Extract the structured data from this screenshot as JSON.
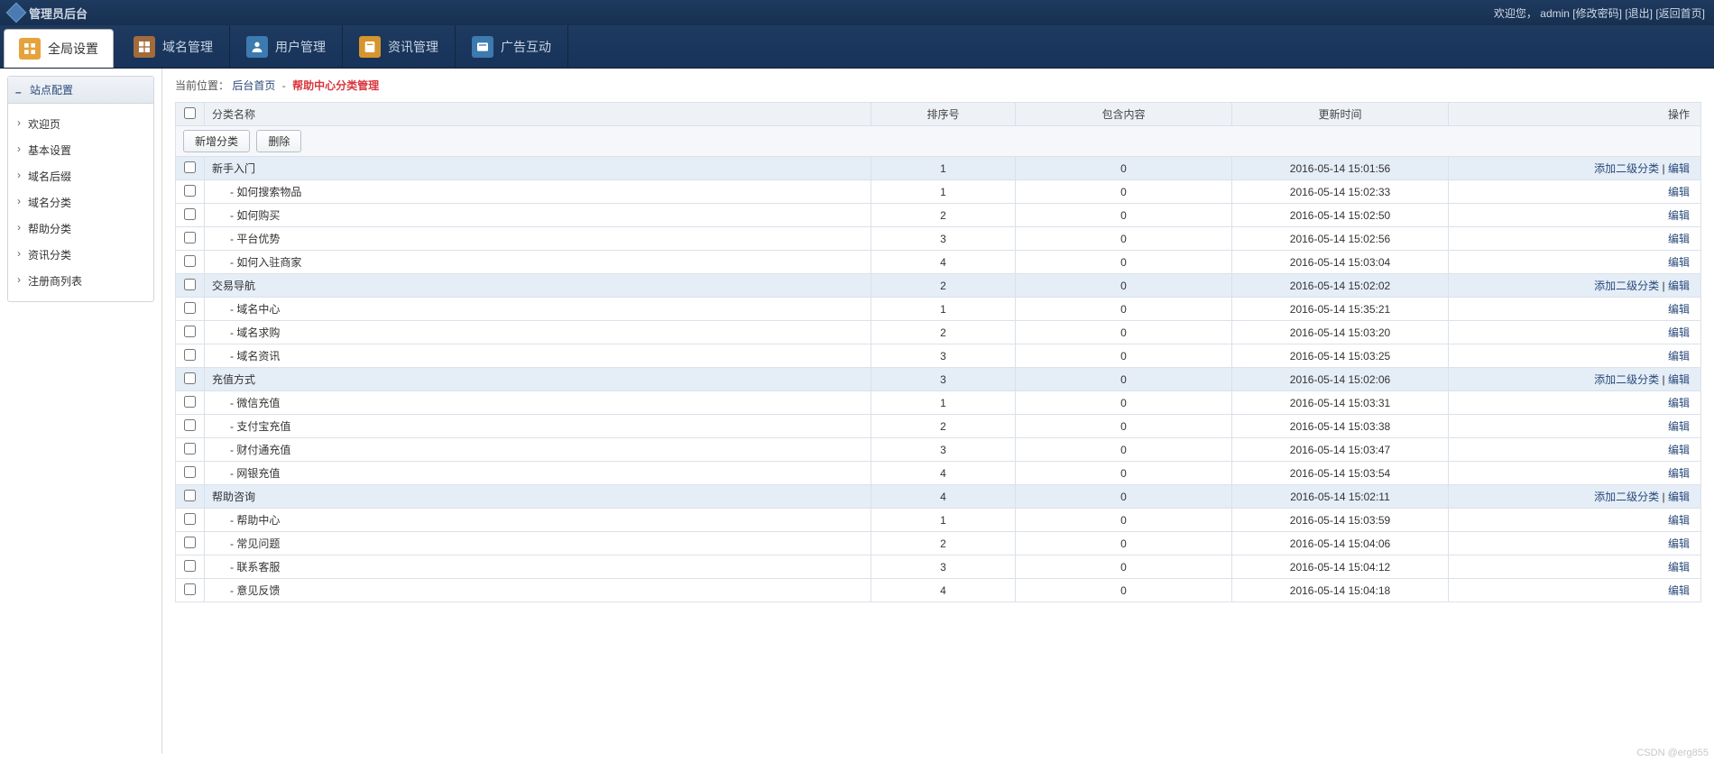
{
  "app_title": "管理员后台",
  "welcome": {
    "prefix": "欢迎您，",
    "user": "admin",
    "change_pwd": "[修改密码]",
    "logout": "[退出]",
    "home": "[返回首页]"
  },
  "nav": [
    {
      "label": "全局设置",
      "icon": "global",
      "active": true
    },
    {
      "label": "域名管理",
      "icon": "domain",
      "active": false
    },
    {
      "label": "用户管理",
      "icon": "user",
      "active": false
    },
    {
      "label": "资讯管理",
      "icon": "info",
      "active": false
    },
    {
      "label": "广告互动",
      "icon": "ad",
      "active": false
    }
  ],
  "side": {
    "panel_title": "站点配置",
    "items": [
      "欢迎页",
      "基本设置",
      "域名后缀",
      "域名分类",
      "帮助分类",
      "资讯分类",
      "注册商列表"
    ]
  },
  "breadcrumb": {
    "label": "当前位置：",
    "root": "后台首页",
    "sep": "-",
    "current": "帮助中心分类管理"
  },
  "columns": {
    "name": "分类名称",
    "sort": "排序号",
    "count": "包含内容",
    "time": "更新时间",
    "op": "操作"
  },
  "buttons": {
    "add": "新增分类",
    "del": "删除"
  },
  "op": {
    "add_sub": "添加二级分类",
    "edit": "编辑",
    "sep": " | "
  },
  "rows": [
    {
      "t": "p",
      "name": "新手入门",
      "sort": "1",
      "count": "0",
      "time": "2016-05-14 15:01:56"
    },
    {
      "t": "c",
      "name": " - 如何搜索物品",
      "sort": "1",
      "count": "0",
      "time": "2016-05-14 15:02:33"
    },
    {
      "t": "c",
      "name": " - 如何购买",
      "sort": "2",
      "count": "0",
      "time": "2016-05-14 15:02:50"
    },
    {
      "t": "c",
      "name": " - 平台优势",
      "sort": "3",
      "count": "0",
      "time": "2016-05-14 15:02:56"
    },
    {
      "t": "c",
      "name": " - 如何入驻商家",
      "sort": "4",
      "count": "0",
      "time": "2016-05-14 15:03:04"
    },
    {
      "t": "p",
      "name": "交易导航",
      "sort": "2",
      "count": "0",
      "time": "2016-05-14 15:02:02"
    },
    {
      "t": "c",
      "name": " - 域名中心",
      "sort": "1",
      "count": "0",
      "time": "2016-05-14 15:35:21"
    },
    {
      "t": "c",
      "name": " - 域名求购",
      "sort": "2",
      "count": "0",
      "time": "2016-05-14 15:03:20"
    },
    {
      "t": "c",
      "name": " - 域名资讯",
      "sort": "3",
      "count": "0",
      "time": "2016-05-14 15:03:25"
    },
    {
      "t": "p",
      "name": "充值方式",
      "sort": "3",
      "count": "0",
      "time": "2016-05-14 15:02:06"
    },
    {
      "t": "c",
      "name": " - 微信充值",
      "sort": "1",
      "count": "0",
      "time": "2016-05-14 15:03:31"
    },
    {
      "t": "c",
      "name": " - 支付宝充值",
      "sort": "2",
      "count": "0",
      "time": "2016-05-14 15:03:38"
    },
    {
      "t": "c",
      "name": " - 财付通充值",
      "sort": "3",
      "count": "0",
      "time": "2016-05-14 15:03:47"
    },
    {
      "t": "c",
      "name": " - 网银充值",
      "sort": "4",
      "count": "0",
      "time": "2016-05-14 15:03:54"
    },
    {
      "t": "p",
      "name": "帮助咨询",
      "sort": "4",
      "count": "0",
      "time": "2016-05-14 15:02:11"
    },
    {
      "t": "c",
      "name": " - 帮助中心",
      "sort": "1",
      "count": "0",
      "time": "2016-05-14 15:03:59"
    },
    {
      "t": "c",
      "name": " - 常见问题",
      "sort": "2",
      "count": "0",
      "time": "2016-05-14 15:04:06"
    },
    {
      "t": "c",
      "name": " - 联系客服",
      "sort": "3",
      "count": "0",
      "time": "2016-05-14 15:04:12"
    },
    {
      "t": "c",
      "name": " - 意见反馈",
      "sort": "4",
      "count": "0",
      "time": "2016-05-14 15:04:18"
    }
  ],
  "watermark": "CSDN @erg855"
}
